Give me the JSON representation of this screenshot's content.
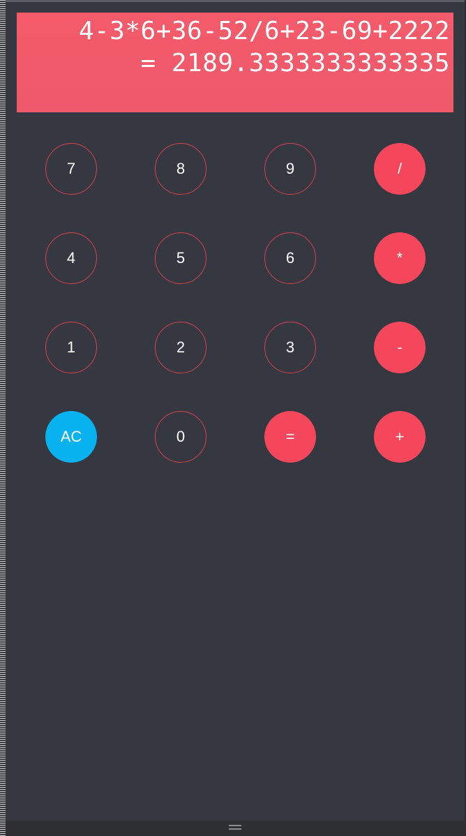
{
  "display": {
    "expression": "4-3*6+36-52/6+23-69+2222",
    "result": "= 2189.3333333333335"
  },
  "keys": {
    "seven": "7",
    "eight": "8",
    "nine": "9",
    "divide": "/",
    "four": "4",
    "five": "5",
    "six": "6",
    "multiply": "*",
    "one": "1",
    "two": "2",
    "three": "3",
    "subtract": "-",
    "clear": "AC",
    "zero": "0",
    "equals": "=",
    "add": "+"
  },
  "colors": {
    "display_bg": "#f45a6a",
    "operator": "#f4475b",
    "number_ring": "#d9414f",
    "clear": "#08b2ef",
    "app_bg": "#353840"
  },
  "icons": {
    "bottom_handle": "drag-handle-icon"
  }
}
